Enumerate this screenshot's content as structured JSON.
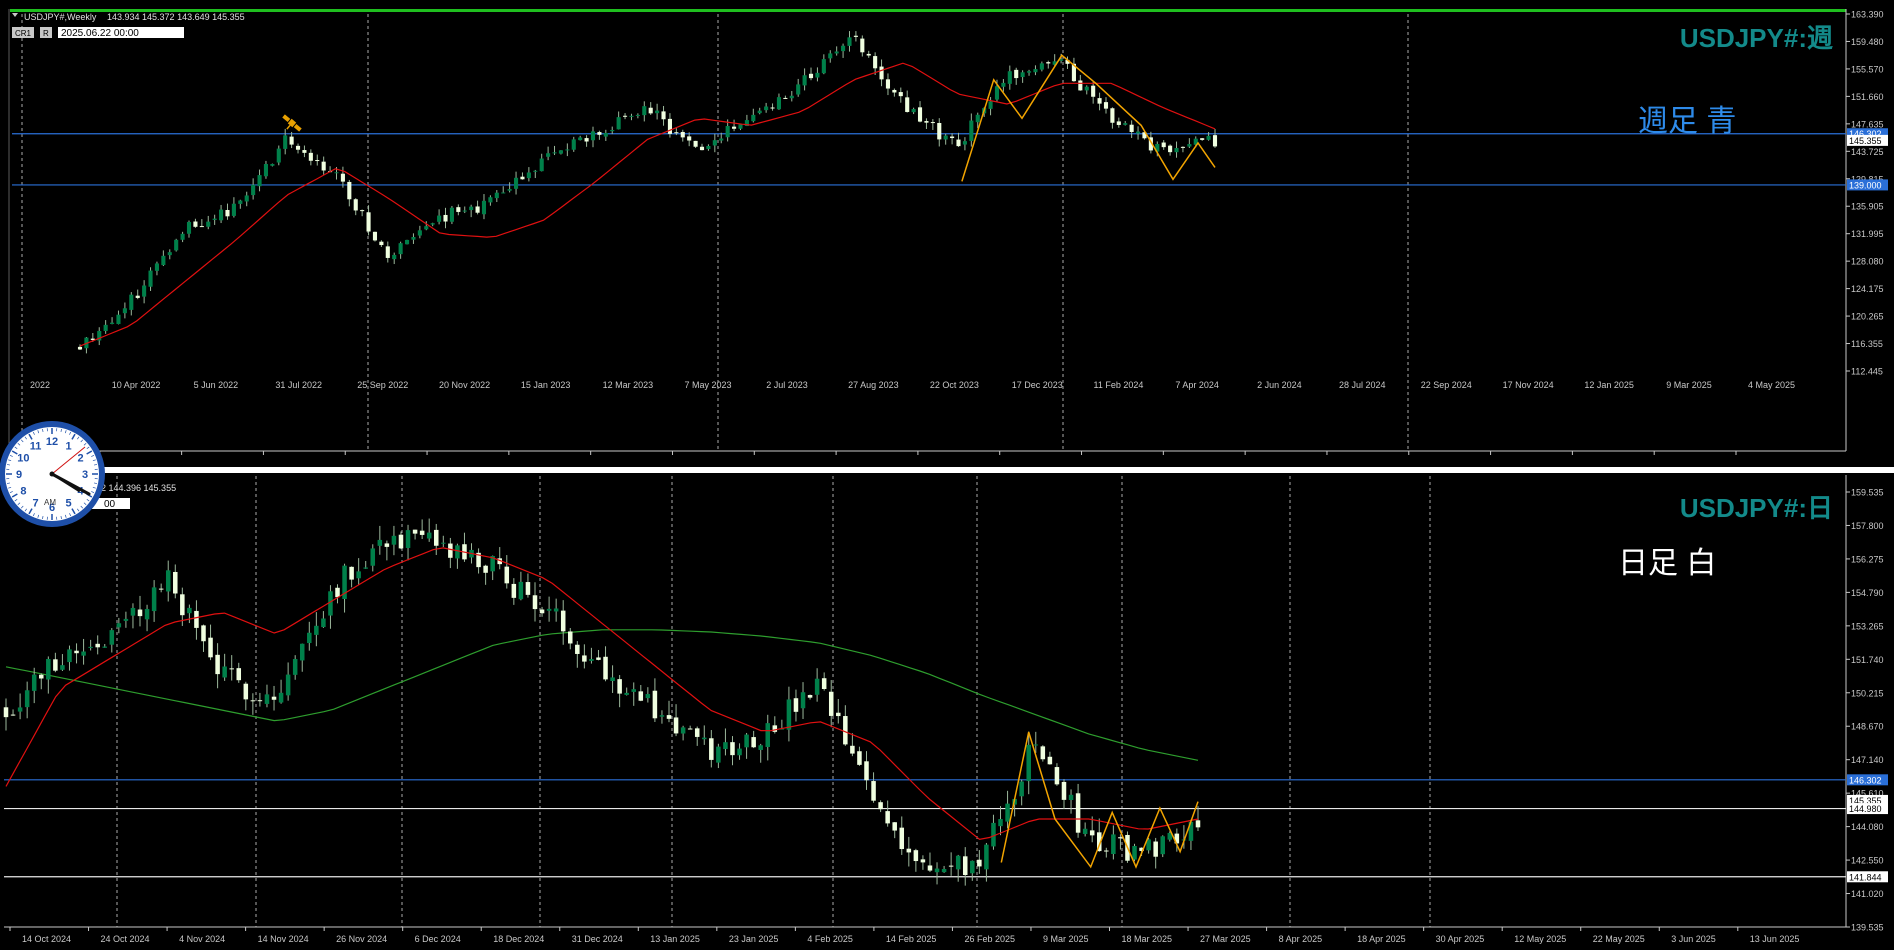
{
  "colors": {
    "background": "#000000",
    "bull_body": "#00804A",
    "bear_body": "#F0FFE0",
    "wick": "#9CB89C",
    "ma_short": "#E01010",
    "ma_long": "#2E9E2E",
    "zigzag": "#F2A400",
    "hline_blue": "#2A6FD8",
    "hline_white": "#E8E8E8",
    "axis_text": "#C8C8C8",
    "grid": "#C8C8C8",
    "title_teal": "#138A8A",
    "label_blue": "#2E8BEA",
    "label_white": "#FFFFFF",
    "top_border_green": "#1FBF1F"
  },
  "panels": [
    {
      "id": "weekly",
      "header": {
        "symbol": "USDJPY#,Weekly",
        "ohlc": "143.934 145.372 143.649 145.355",
        "tag_cr": "CR1",
        "tag_r": "R",
        "datetime": "2025.06.22 00:00"
      },
      "title": "USDJPY#:週",
      "caption": "週足  青",
      "icon": "satellite-icon",
      "y_ticks": [
        "163.390",
        "159.480",
        "155.570",
        "151.660",
        "147.635",
        "143.725",
        "139.815",
        "135.905",
        "131.995",
        "128.080",
        "124.175",
        "120.265",
        "116.355",
        "112.445"
      ],
      "x_ticks": [
        "2022",
        "10 Apr 2022",
        "5 Jun 2022",
        "31 Jul 2022",
        "25 Sep 2022",
        "20 Nov 2022",
        "15 Jan 2023",
        "12 Mar 2023",
        "7 May 2023",
        "2 Jul 2023",
        "27 Aug 2023",
        "22 Oct 2023",
        "17 Dec 2023",
        "11 Feb 2024",
        "7 Apr 2024",
        "2 Jun 2024",
        "28 Jul 2024",
        "22 Sep 2024",
        "17 Nov 2024",
        "12 Jan 2025",
        "9 Mar 2025",
        "4 May 2025"
      ],
      "price_tags": [
        {
          "label": "146.302",
          "style": "blue"
        },
        {
          "label": "145.355",
          "style": "white"
        },
        {
          "label": "139.000",
          "style": "blue"
        }
      ]
    },
    {
      "id": "daily",
      "header": {
        "ohlc_partial": "72 144.396 145.355",
        "datetime_partial": "00"
      },
      "title": "USDJPY#:日",
      "caption": "日足   白",
      "y_ticks": [
        "159.535",
        "157.800",
        "156.275",
        "154.790",
        "153.265",
        "151.740",
        "150.215",
        "148.670",
        "147.140",
        "145.610",
        "144.080",
        "142.550",
        "141.020",
        "139.535"
      ],
      "x_ticks": [
        "14 Oct 2024",
        "24 Oct 2024",
        "4 Nov 2024",
        "14 Nov 2024",
        "26 Nov 2024",
        "6 Dec 2024",
        "18 Dec 2024",
        "31 Dec 2024",
        "13 Jan 2025",
        "23 Jan 2025",
        "4 Feb 2025",
        "14 Feb 2025",
        "26 Feb 2025",
        "9 Mar 2025",
        "18 Mar 2025",
        "27 Mar 2025",
        "8 Apr 2025",
        "18 Apr 2025",
        "30 Apr 2025",
        "12 May 2025",
        "22 May 2025",
        "3 Jun 2025",
        "13 Jun 2025"
      ],
      "price_tags": [
        {
          "label": "146.302",
          "style": "blue"
        },
        {
          "label": "145.355",
          "style": "white"
        },
        {
          "label": "144.980",
          "style": "white"
        },
        {
          "label": "141.844",
          "style": "white"
        }
      ]
    }
  ],
  "clock": {
    "numbers": [
      "12",
      "1",
      "2",
      "3",
      "4",
      "5",
      "6",
      "7",
      "8",
      "9",
      "10",
      "11"
    ],
    "ampm": "AM"
  },
  "chart_data": [
    {
      "type": "candlestick",
      "title": "USDJPY#:週",
      "symbol": "USDJPY#",
      "timeframe": "Weekly",
      "ylim": [
        112.445,
        163.39
      ],
      "x_range": [
        "2022",
        "22 Jun 2025"
      ],
      "last_bar": {
        "open": 143.934,
        "high": 145.372,
        "low": 143.649,
        "close": 145.355
      },
      "series": [
        {
          "kind": "close",
          "x": [
            "2022-02",
            "2022-04",
            "2022-06",
            "2022-08",
            "2022-10",
            "2022-11",
            "2023-01",
            "2023-03",
            "2023-05",
            "2023-07",
            "2023-09",
            "2023-10",
            "2023-12",
            "2024-02",
            "2024-04",
            "2024-06",
            "2024-07",
            "2024-09",
            "2024-11",
            "2025-01",
            "2025-03",
            "2025-05",
            "2025-06"
          ],
          "values": [
            116.0,
            122.5,
            133.0,
            135.5,
            145.5,
            140.0,
            128.5,
            134.5,
            136.5,
            142.5,
            146.5,
            150.0,
            143.5,
            149.0,
            153.5,
            160.5,
            150.0,
            144.5,
            154.5,
            156.5,
            148.5,
            143.5,
            145.355
          ]
        },
        {
          "kind": "moving_average",
          "values": [
            116.0,
            119.0,
            125.0,
            131.0,
            137.5,
            141.5,
            137.0,
            132.0,
            131.5,
            134.0,
            139.5,
            145.5,
            148.5,
            147.5,
            149.5,
            154.0,
            156.5,
            152.0,
            150.5,
            153.5,
            153.5,
            150.0,
            147.0
          ]
        }
      ],
      "hlines": [
        146.302,
        139.0
      ],
      "current_price": 145.355
    },
    {
      "type": "candlestick",
      "title": "USDJPY#:日",
      "symbol": "USDJPY#",
      "timeframe": "Daily",
      "ylim": [
        139.535,
        159.535
      ],
      "x_range": [
        "14 Oct 2024",
        "20 Jun 2025"
      ],
      "series": [
        {
          "kind": "close",
          "x": [
            "2024-10-14",
            "2024-10-24",
            "2024-11-04",
            "2024-11-14",
            "2024-11-26",
            "2024-12-06",
            "2024-12-18",
            "2024-12-31",
            "2025-01-13",
            "2025-01-23",
            "2025-02-04",
            "2025-02-14",
            "2025-02-26",
            "2025-03-09",
            "2025-03-18",
            "2025-03-27",
            "2025-04-08",
            "2025-04-18",
            "2025-04-30",
            "2025-05-12",
            "2025-05-22",
            "2025-06-03",
            "2025-06-13"
          ],
          "values": [
            149.5,
            152.0,
            153.0,
            155.5,
            151.0,
            150.0,
            155.0,
            157.5,
            157.0,
            156.0,
            154.0,
            151.5,
            149.5,
            147.5,
            148.5,
            150.5,
            145.5,
            142.0,
            142.5,
            148.0,
            143.5,
            143.0,
            144.5
          ]
        },
        {
          "kind": "moving_average_short",
          "values": [
            146.0,
            150.5,
            152.0,
            153.5,
            154.0,
            153.0,
            154.5,
            156.0,
            157.0,
            156.5,
            155.5,
            153.5,
            151.5,
            149.5,
            148.5,
            149.0,
            148.0,
            145.5,
            143.5,
            144.5,
            144.5,
            144.0,
            144.5
          ]
        },
        {
          "kind": "moving_average_long",
          "values": [
            151.5,
            151.0,
            150.5,
            150.0,
            149.5,
            149.0,
            149.5,
            150.5,
            151.5,
            152.5,
            153.0,
            153.2,
            153.2,
            153.1,
            152.9,
            152.6,
            152.0,
            151.2,
            150.2,
            149.3,
            148.4,
            147.7,
            147.2
          ]
        }
      ],
      "hlines": [
        146.302,
        144.98,
        141.844
      ],
      "current_price": 145.355
    }
  ]
}
